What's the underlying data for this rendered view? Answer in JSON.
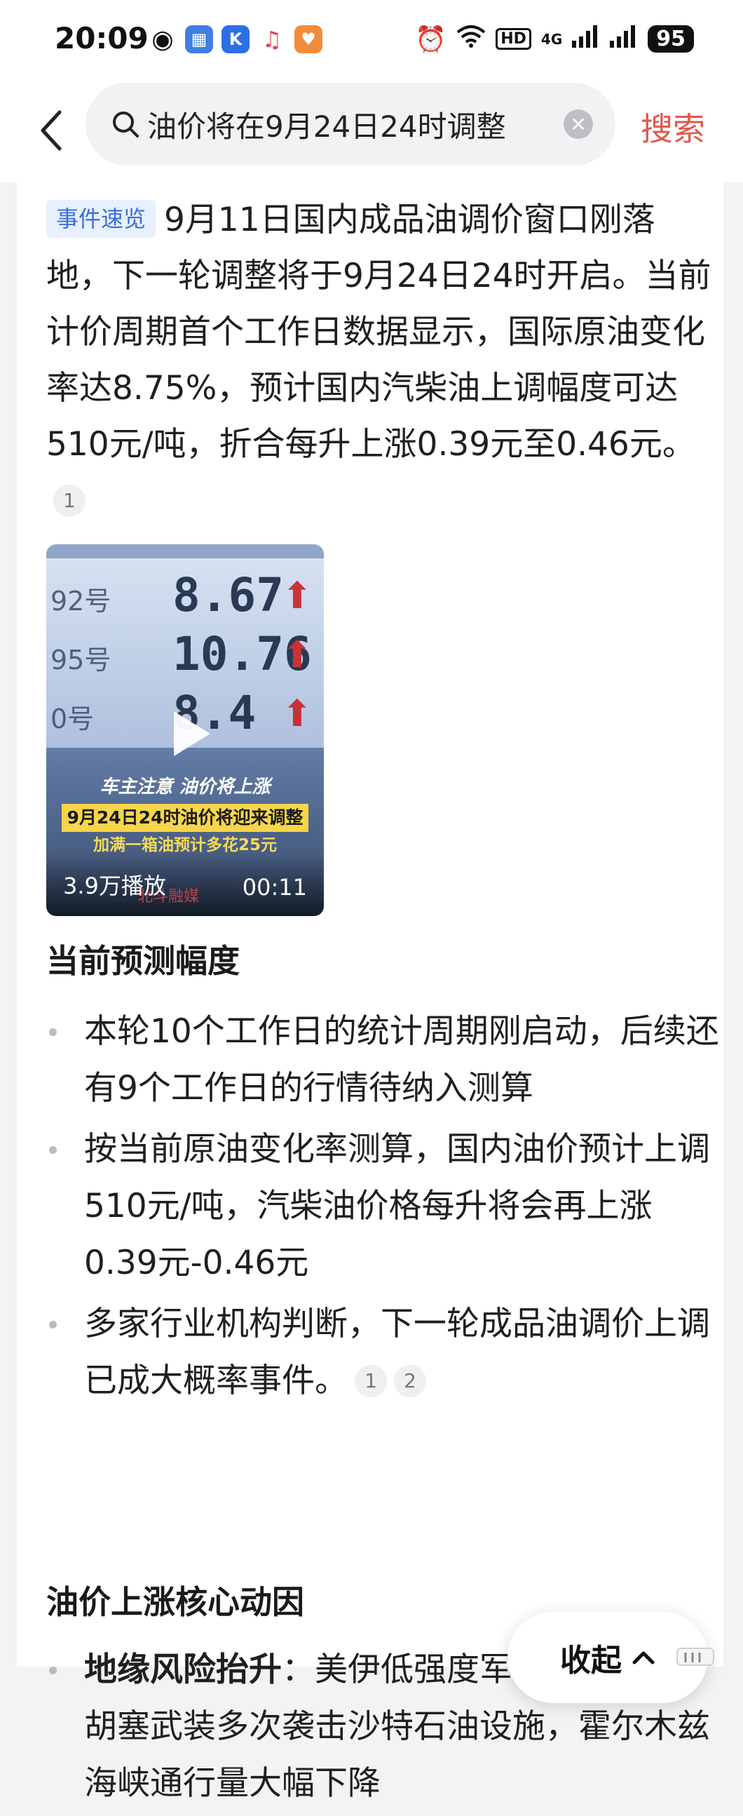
{
  "status_bar": {
    "time": "20:09",
    "network": "HD",
    "signal_4g": "4G",
    "battery": "95"
  },
  "search": {
    "query": "油价将在9月24日24时调整",
    "submit_label": "搜索"
  },
  "summary": {
    "tag": "事件速览",
    "text": "9月11日国内成品油调价窗口刚落地，下一轮调整将于9月24日24时开启。当前计价周期首个工作日数据显示，国际原油变化率达8.75%，预计国内汽柴油上调幅度可达510元/吨，折合每升上涨0.39元至0.46元。",
    "citation": "1"
  },
  "video": {
    "board": [
      {
        "grade": "92号",
        "price": "8.67"
      },
      {
        "grade": "95号",
        "price": "10.76"
      },
      {
        "grade": "0号",
        "price": "8.4"
      }
    ],
    "caption_line1": "车主注意 油价将上涨",
    "caption_line2": "9月24日24时油价将迎来调整",
    "caption_line3": "加满一箱油预计多花25元",
    "source": "北斗融媒",
    "play_count": "3.9万播放",
    "duration": "00:11"
  },
  "section1": {
    "title": "当前预测幅度",
    "items": [
      {
        "text": "本轮10个工作日的统计周期刚启动，后续还有9个工作日的行情待纳入测算"
      },
      {
        "text": "按当前原油变化率测算，国内油价预计上调510元/吨，汽柴油价格每升将会再上涨0.39元-0.46元"
      },
      {
        "text": "多家行业机构判断，下一轮成品油调价上调已成大概率事件。",
        "citations": [
          "1",
          "2"
        ]
      }
    ]
  },
  "section2": {
    "title": "油价上涨核心动因",
    "items": [
      {
        "lead": "地缘风险抬升",
        "separator": "：",
        "text": "美伊低强度军事冲突持续，胡塞武装多次袭击沙特石油设施，霍尔木兹海峡通行量大幅下降"
      }
    ]
  },
  "collapse": {
    "label": "收起"
  },
  "colors": {
    "accent_red": "#e2574c",
    "tag_blue": "#3a6fd8",
    "tag_bg": "#e8f0fd"
  }
}
